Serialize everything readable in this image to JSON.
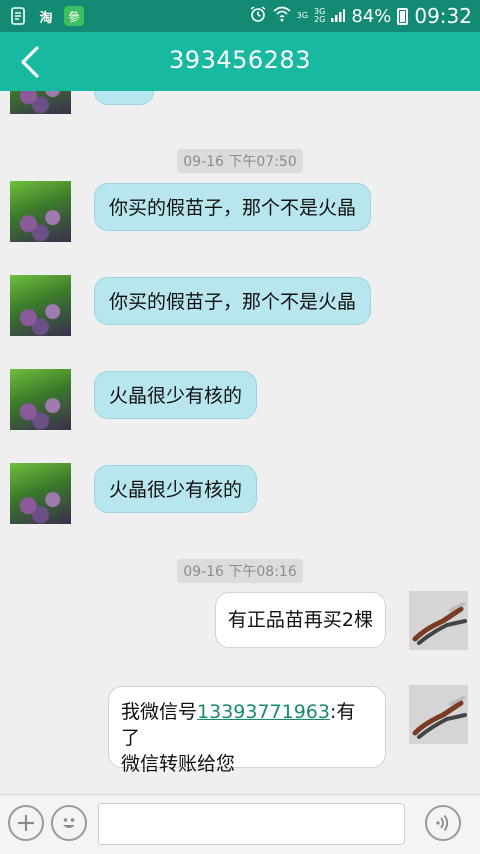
{
  "status_bar": {
    "app_icon_1": "taobao-app-icon",
    "app_icon_1_text": "淘",
    "app_icon_2": "green-app-icon",
    "app_icon_2_text": "參",
    "net_top": "3G",
    "net_a": "3G",
    "net_b": "2G",
    "battery": "84%",
    "battery_level": 0.84,
    "time": "09:32"
  },
  "header": {
    "title": "393456283"
  },
  "messages": {
    "time1": "09-16 下午07:50",
    "m1": "你买的假苗子，那个不是火晶",
    "m2": "你买的假苗子，那个不是火晶",
    "m3": "火晶很少有核的",
    "m4": "火晶很少有核的",
    "time2": "09-16 下午08:16",
    "m5": "有正品苗再买2棵",
    "m6_prefix": "我微信号",
    "m6_link": "13393771963",
    "m6_suffix": ":有了",
    "m6_line2": "微信转账给您"
  },
  "colors": {
    "status_bar": "#128a74",
    "title_bar": "#17b9a1",
    "incoming_bubble": "#b7e6ee",
    "outgoing_bubble": "#ffffff",
    "link": "#1a8a6e",
    "background": "#efefef"
  }
}
